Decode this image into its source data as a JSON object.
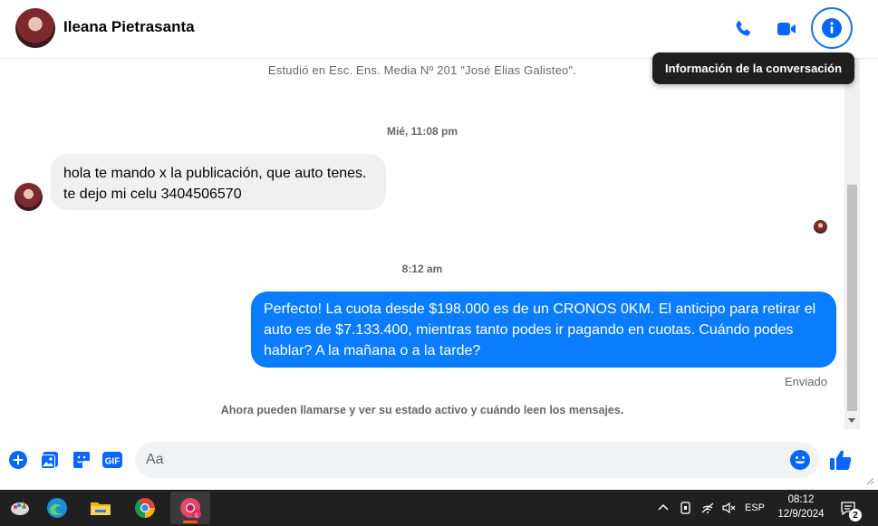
{
  "header": {
    "contact_name": "Ileana Pietrasanta",
    "tooltip": "Información de la conversación"
  },
  "conversation": {
    "profile_text": "Estudió en Esc. Ens. Media Nº 201 \"José Elias Galisteo\".",
    "timestamp_1": "Mié, 11:08 pm",
    "incoming_line_1": "hola te mando x la publicación, que auto tenes.",
    "incoming_line_2": "te dejo mi celu 3404506570",
    "timestamp_2": "8:12 am",
    "outgoing_message": "Perfecto! La cuota desde $198.000 es de un CRONOS 0KM. El anticipo para retirar el auto es de $7.133.400, mientras tanto podes ir pagando en cuotas. Cuándo podes hablar? A la mañana o a la tarde?",
    "status": "Enviado",
    "notice": "Ahora pueden llamarse y ver su estado activo y cuándo leen los mensajes."
  },
  "composer": {
    "placeholder": "Aa",
    "gif_label": "GIF"
  },
  "taskbar": {
    "language": "ESP",
    "time": "08:12",
    "date": "12/9/2024",
    "notifications": "2"
  },
  "colors": {
    "accent": "#0a7cff",
    "icon_blue": "#0866ff"
  }
}
